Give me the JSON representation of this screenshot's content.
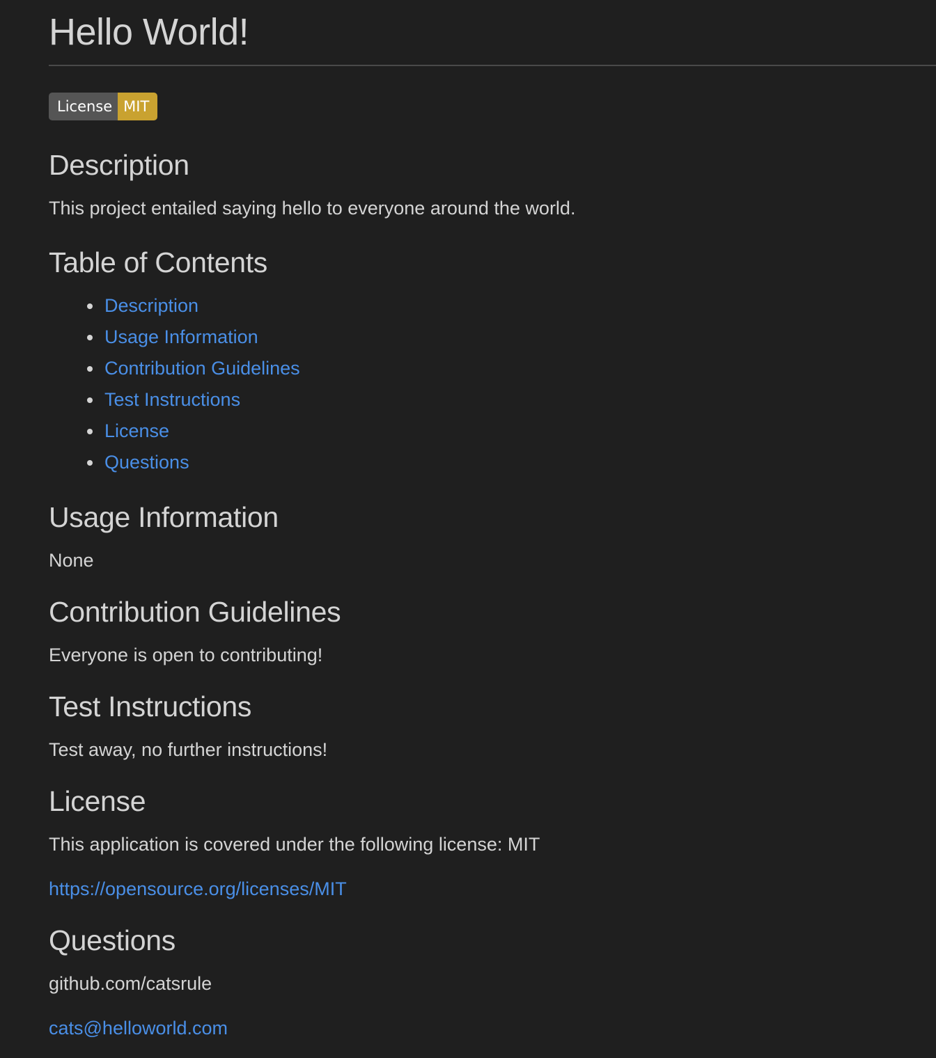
{
  "title": "Hello World!",
  "badge": {
    "label": "License",
    "value": "MIT",
    "label_color": "#555555",
    "value_color": "#c9a230"
  },
  "sections": {
    "description": {
      "heading": "Description",
      "text": "This project entailed saying hello to everyone around the world."
    },
    "toc": {
      "heading": "Table of Contents",
      "items": [
        "Description",
        "Usage Information",
        "Contribution Guidelines",
        "Test Instructions",
        "License",
        "Questions"
      ]
    },
    "usage": {
      "heading": "Usage Information",
      "text": "None"
    },
    "contribution": {
      "heading": "Contribution Guidelines",
      "text": "Everyone is open to contributing!"
    },
    "tests": {
      "heading": "Test Instructions",
      "text": "Test away, no further instructions!"
    },
    "license": {
      "heading": "License",
      "text": "This application is covered under the following license: MIT",
      "link": "https://opensource.org/licenses/MIT"
    },
    "questions": {
      "heading": "Questions",
      "github": "github.com/catsrule",
      "email": "cats@helloworld.com"
    }
  },
  "colors": {
    "background": "#1f1f1f",
    "text": "#d4d4d4",
    "link": "#4a8fe7"
  }
}
